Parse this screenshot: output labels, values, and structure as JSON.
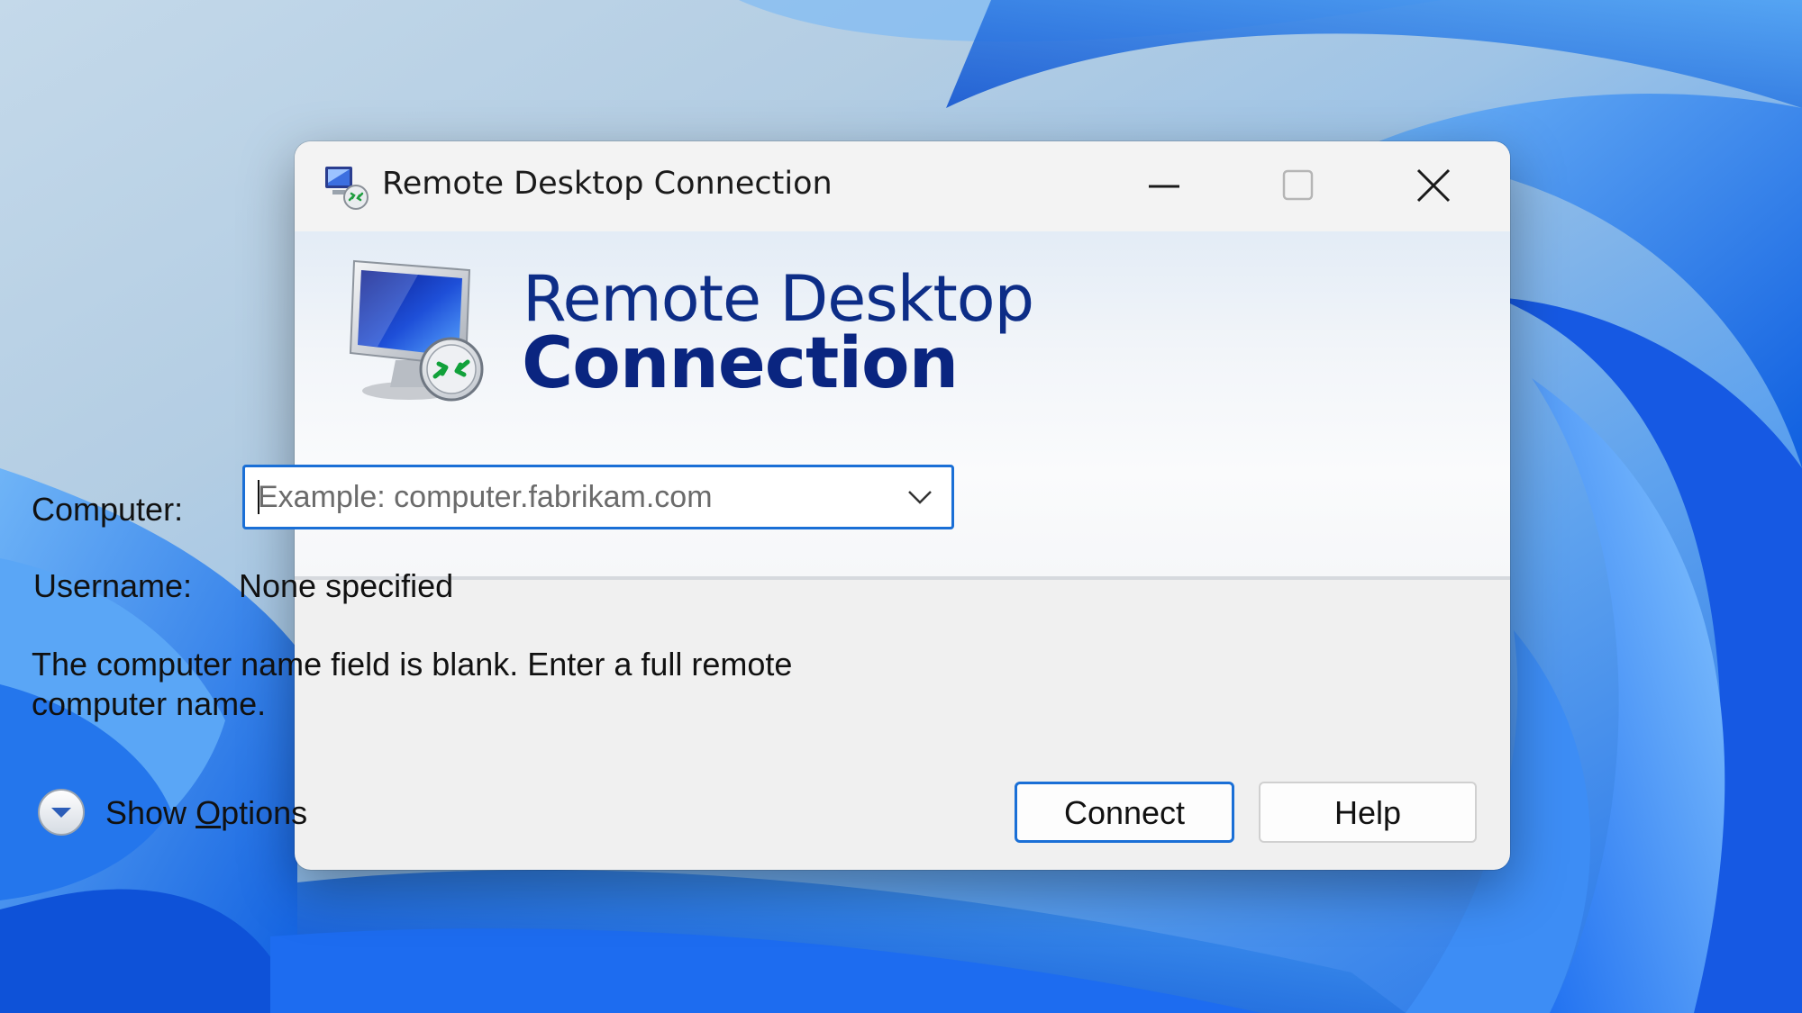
{
  "window": {
    "title": "Remote Desktop Connection",
    "controls": {
      "minimize": "minimize",
      "maximize": "maximize",
      "close": "close"
    }
  },
  "banner": {
    "line1": "Remote Desktop",
    "line2": "Connection"
  },
  "form": {
    "computer_label": "Computer:",
    "computer_value": "",
    "computer_placeholder": "Example: computer.fabrikam.com",
    "username_label": "Username:",
    "username_value": "None specified"
  },
  "message": "The computer name field is blank. Enter a full remote computer name.",
  "footer": {
    "show_options_prefix": "Show ",
    "show_options_accel": "O",
    "show_options_suffix": "ptions",
    "connect_label": "Connect",
    "help_label": "Help"
  },
  "colors": {
    "accent": "#1a6fd6",
    "banner_text": "#0d2d87"
  },
  "icons": {
    "title": "remote-desktop-icon",
    "banner": "monitor-connection-icon",
    "dropdown": "chevron-down-icon",
    "show_options": "expand-circle-icon"
  }
}
